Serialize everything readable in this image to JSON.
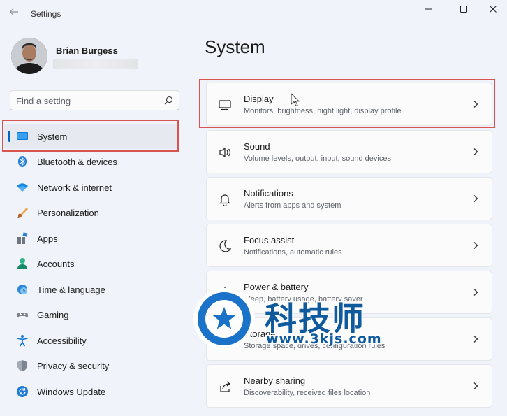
{
  "app": {
    "title": "Settings"
  },
  "window_controls": [
    "minimize",
    "maximize",
    "close"
  ],
  "user": {
    "name": "Brian Burgess",
    "email": ""
  },
  "search": {
    "placeholder": "Find a setting",
    "value": ""
  },
  "sidebar": {
    "selected": "System",
    "items": [
      {
        "label": "System",
        "icon": "monitor-icon"
      },
      {
        "label": "Bluetooth & devices",
        "icon": "bluetooth-icon"
      },
      {
        "label": "Network & internet",
        "icon": "wifi-icon"
      },
      {
        "label": "Personalization",
        "icon": "brush-icon"
      },
      {
        "label": "Apps",
        "icon": "apps-icon"
      },
      {
        "label": "Accounts",
        "icon": "person-icon"
      },
      {
        "label": "Time & language",
        "icon": "globe-clock-icon"
      },
      {
        "label": "Gaming",
        "icon": "gamepad-icon"
      },
      {
        "label": "Accessibility",
        "icon": "accessibility-icon"
      },
      {
        "label": "Privacy & security",
        "icon": "shield-icon"
      },
      {
        "label": "Windows Update",
        "icon": "update-icon"
      }
    ]
  },
  "main": {
    "title": "System",
    "cards": [
      {
        "title": "Display",
        "subtitle": "Monitors, brightness, night light, display profile",
        "icon": "display-icon",
        "highlighted": true
      },
      {
        "title": "Sound",
        "subtitle": "Volume levels, output, input, sound devices",
        "icon": "speaker-icon"
      },
      {
        "title": "Notifications",
        "subtitle": "Alerts from apps and system",
        "icon": "bell-icon"
      },
      {
        "title": "Focus assist",
        "subtitle": "Notifications, automatic rules",
        "icon": "moon-icon"
      },
      {
        "title": "Power & battery",
        "subtitle": "Sleep, battery usage, battery saver",
        "icon": "power-icon"
      },
      {
        "title": "Storage",
        "subtitle": "Storage space, drives, configuration rules",
        "icon": "storage-icon"
      },
      {
        "title": "Nearby sharing",
        "subtitle": "Discoverability, received files location",
        "icon": "share-icon"
      }
    ]
  },
  "watermark": {
    "text": "科技师",
    "url": "www.3kjs.com"
  },
  "colors": {
    "accent": "#0067c0",
    "highlight": "#d9534f",
    "watermark": "#0f5a9c"
  }
}
